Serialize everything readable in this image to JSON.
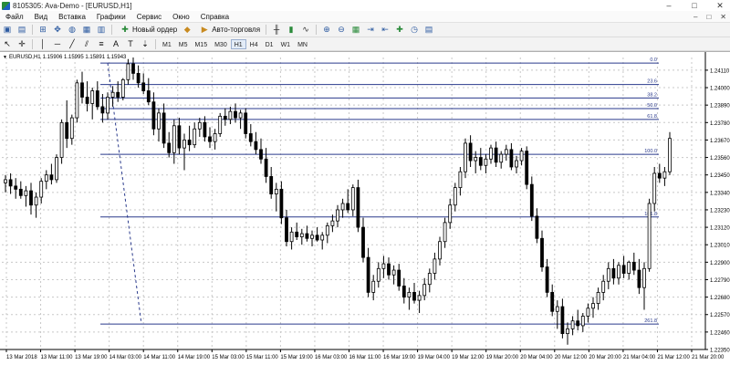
{
  "window": {
    "title": "8105305: Ava-Demo - [EURUSD,H1]",
    "controls": [
      "–",
      "□",
      "✕"
    ]
  },
  "menu": {
    "items": [
      "Файл",
      "Вид",
      "Вставка",
      "Графики",
      "Сервис",
      "Окно",
      "Справка"
    ],
    "mdi_controls": [
      "–",
      "□",
      "✕"
    ]
  },
  "toolbar": {
    "new_order": "Новый ордер",
    "auto_trading": "Авто-торговля",
    "timeframes": [
      "M1",
      "M5",
      "M15",
      "M30",
      "H1",
      "H4",
      "D1",
      "W1",
      "MN"
    ],
    "active_timeframe": "H1"
  },
  "chart": {
    "symbol": "EURUSD,H1",
    "ohlc": "1.15906 1.15995 1.15891 1.15943",
    "price_ticks": [
      "1.24110",
      "1.24000",
      "1.23890",
      "1.23780",
      "1.23670",
      "1.23560",
      "1.23450",
      "1.23340",
      "1.23230",
      "1.23120",
      "1.23010",
      "1.22900",
      "1.22790",
      "1.22680",
      "1.22570",
      "1.22460",
      "1.22350"
    ],
    "time_ticks": [
      "13 Mar 2018",
      "13 Mar 11:00",
      "13 Mar 19:00",
      "14 Mar 03:00",
      "14 Mar 11:00",
      "14 Mar 19:00",
      "15 Mar 03:00",
      "15 Mar 11:00",
      "15 Mar 19:00",
      "16 Mar 03:00",
      "16 Mar 11:00",
      "16 Mar 19:00",
      "19 Mar 04:00",
      "19 Mar 12:00",
      "19 Mar 20:00",
      "20 Mar 04:00",
      "20 Mar 12:00",
      "20 Mar 20:00",
      "21 Mar 04:00",
      "21 Mar 12:00",
      "21 Mar 20:00"
    ],
    "fib_levels": [
      {
        "label": "0.0",
        "price": 1.24155
      },
      {
        "label": "23.6",
        "price": 1.2402
      },
      {
        "label": "38.2",
        "price": 1.23935
      },
      {
        "label": "50.0",
        "price": 1.23868
      },
      {
        "label": "61.8",
        "price": 1.238
      },
      {
        "label": "100.0",
        "price": 1.2358
      },
      {
        "label": "161.8",
        "price": 1.23185
      },
      {
        "label": "261.8",
        "price": 1.2251
      }
    ],
    "colors": {
      "bull": "#ffffff",
      "bear": "#000000",
      "fib": "#2a3a8c",
      "grid": "#c8c8c8",
      "ask_line": "#000000"
    }
  },
  "chart_data": {
    "type": "candlestick",
    "symbol": "EURUSD,H1",
    "ylim": [
      1.2235,
      1.2419
    ],
    "candles": [
      [
        1.234,
        1.2345,
        1.2334,
        1.2342
      ],
      [
        1.2342,
        1.2346,
        1.2333,
        1.2338
      ],
      [
        1.2338,
        1.2343,
        1.233,
        1.2336
      ],
      [
        1.2336,
        1.2341,
        1.233,
        1.2332
      ],
      [
        1.2332,
        1.2338,
        1.2325,
        1.2335
      ],
      [
        1.2335,
        1.234,
        1.232,
        1.2326
      ],
      [
        1.2326,
        1.2334,
        1.2318,
        1.2331
      ],
      [
        1.2331,
        1.2343,
        1.2327,
        1.2341
      ],
      [
        1.2341,
        1.2348,
        1.2336,
        1.2345
      ],
      [
        1.2345,
        1.2352,
        1.2339,
        1.2342
      ],
      [
        1.2342,
        1.2358,
        1.234,
        1.2356
      ],
      [
        1.2356,
        1.238,
        1.2352,
        1.2378
      ],
      [
        1.2378,
        1.2392,
        1.2362,
        1.2368
      ],
      [
        1.2368,
        1.2383,
        1.2364,
        1.2381
      ],
      [
        1.2381,
        1.2405,
        1.2378,
        1.2403
      ],
      [
        1.2403,
        1.241,
        1.239,
        1.2394
      ],
      [
        1.2394,
        1.2404,
        1.2385,
        1.239
      ],
      [
        1.239,
        1.24,
        1.238,
        1.2398
      ],
      [
        1.2398,
        1.2404,
        1.2386,
        1.2388
      ],
      [
        1.2388,
        1.2396,
        1.2378,
        1.2384
      ],
      [
        1.2384,
        1.2397,
        1.238,
        1.2394
      ],
      [
        1.2394,
        1.2401,
        1.2388,
        1.2397
      ],
      [
        1.2397,
        1.2404,
        1.2391,
        1.2394
      ],
      [
        1.2394,
        1.2406,
        1.2392,
        1.2405
      ],
      [
        1.2405,
        1.2418,
        1.2402,
        1.2415
      ],
      [
        1.2415,
        1.2419,
        1.2405,
        1.2409
      ],
      [
        1.2409,
        1.2414,
        1.24,
        1.2403
      ],
      [
        1.2403,
        1.2409,
        1.2396,
        1.2398
      ],
      [
        1.2398,
        1.2406,
        1.2389,
        1.2391
      ],
      [
        1.2391,
        1.2397,
        1.237,
        1.2374
      ],
      [
        1.2374,
        1.2387,
        1.2366,
        1.2384
      ],
      [
        1.2384,
        1.239,
        1.2362,
        1.2365
      ],
      [
        1.2365,
        1.2372,
        1.2356,
        1.2359
      ],
      [
        1.2359,
        1.238,
        1.2352,
        1.2376
      ],
      [
        1.2376,
        1.2381,
        1.2358,
        1.2362
      ],
      [
        1.2362,
        1.2371,
        1.2348,
        1.2367
      ],
      [
        1.2367,
        1.2376,
        1.236,
        1.2364
      ],
      [
        1.2364,
        1.2378,
        1.2362,
        1.2374
      ],
      [
        1.2374,
        1.2381,
        1.2369,
        1.2378
      ],
      [
        1.2378,
        1.2382,
        1.2366,
        1.2369
      ],
      [
        1.2369,
        1.2375,
        1.2362,
        1.2366
      ],
      [
        1.2366,
        1.2374,
        1.2361,
        1.2371
      ],
      [
        1.2371,
        1.2384,
        1.2369,
        1.2382
      ],
      [
        1.2382,
        1.2387,
        1.2376,
        1.238
      ],
      [
        1.238,
        1.2388,
        1.2377,
        1.2385
      ],
      [
        1.2385,
        1.239,
        1.2378,
        1.2381
      ],
      [
        1.2381,
        1.2386,
        1.2374,
        1.2384
      ],
      [
        1.2384,
        1.2387,
        1.2368,
        1.2371
      ],
      [
        1.2371,
        1.2377,
        1.2363,
        1.2366
      ],
      [
        1.2366,
        1.2372,
        1.2358,
        1.2361
      ],
      [
        1.2361,
        1.2368,
        1.2352,
        1.2355
      ],
      [
        1.2355,
        1.2362,
        1.234,
        1.2344
      ],
      [
        1.2344,
        1.235,
        1.233,
        1.2333
      ],
      [
        1.2333,
        1.234,
        1.2322,
        1.2336
      ],
      [
        1.2336,
        1.2341,
        1.2314,
        1.2318
      ],
      [
        1.2318,
        1.2323,
        1.23,
        1.2303
      ],
      [
        1.2303,
        1.2312,
        1.2298,
        1.2309
      ],
      [
        1.2309,
        1.2315,
        1.2304,
        1.2306
      ],
      [
        1.2306,
        1.2311,
        1.2301,
        1.2308
      ],
      [
        1.2308,
        1.2313,
        1.2303,
        1.2305
      ],
      [
        1.2305,
        1.231,
        1.23,
        1.2307
      ],
      [
        1.2307,
        1.2312,
        1.2303,
        1.2304
      ],
      [
        1.2304,
        1.2309,
        1.2298,
        1.2307
      ],
      [
        1.2307,
        1.2315,
        1.2302,
        1.2313
      ],
      [
        1.2313,
        1.232,
        1.2309,
        1.2316
      ],
      [
        1.2316,
        1.2326,
        1.2312,
        1.2323
      ],
      [
        1.2323,
        1.233,
        1.2318,
        1.2327
      ],
      [
        1.2327,
        1.2336,
        1.2321,
        1.2323
      ],
      [
        1.2323,
        1.2339,
        1.2319,
        1.2337
      ],
      [
        1.2337,
        1.2342,
        1.2309,
        1.2312
      ],
      [
        1.2312,
        1.2318,
        1.229,
        1.2293
      ],
      [
        1.2293,
        1.2299,
        1.2268,
        1.2271
      ],
      [
        1.2271,
        1.2282,
        1.2266,
        1.2278
      ],
      [
        1.2278,
        1.229,
        1.2274,
        1.2286
      ],
      [
        1.2286,
        1.2294,
        1.228,
        1.2289
      ],
      [
        1.2289,
        1.2293,
        1.2279,
        1.2282
      ],
      [
        1.2282,
        1.2288,
        1.2276,
        1.2285
      ],
      [
        1.2285,
        1.2289,
        1.2272,
        1.2275
      ],
      [
        1.2275,
        1.228,
        1.2264,
        1.2268
      ],
      [
        1.2268,
        1.2274,
        1.226,
        1.2271
      ],
      [
        1.2271,
        1.2277,
        1.2264,
        1.2266
      ],
      [
        1.2266,
        1.2272,
        1.2258,
        1.2269
      ],
      [
        1.2269,
        1.228,
        1.2266,
        1.2276
      ],
      [
        1.2276,
        1.2286,
        1.2271,
        1.2283
      ],
      [
        1.2283,
        1.2296,
        1.2279,
        1.2292
      ],
      [
        1.2292,
        1.2306,
        1.2288,
        1.2303
      ],
      [
        1.2303,
        1.2318,
        1.2299,
        1.2315
      ],
      [
        1.2315,
        1.233,
        1.2311,
        1.2326
      ],
      [
        1.2326,
        1.234,
        1.2322,
        1.2337
      ],
      [
        1.2337,
        1.235,
        1.2332,
        1.2347
      ],
      [
        1.2347,
        1.2368,
        1.2343,
        1.2365
      ],
      [
        1.2365,
        1.237,
        1.235,
        1.2354
      ],
      [
        1.2354,
        1.236,
        1.2346,
        1.2356
      ],
      [
        1.2356,
        1.2362,
        1.2348,
        1.2351
      ],
      [
        1.2351,
        1.2358,
        1.2346,
        1.2355
      ],
      [
        1.2355,
        1.2364,
        1.2352,
        1.2362
      ],
      [
        1.2362,
        1.2366,
        1.235,
        1.2353
      ],
      [
        1.2353,
        1.236,
        1.2349,
        1.2358
      ],
      [
        1.2358,
        1.2364,
        1.2354,
        1.2361
      ],
      [
        1.2361,
        1.2365,
        1.2348,
        1.235
      ],
      [
        1.235,
        1.2357,
        1.2346,
        1.2354
      ],
      [
        1.2354,
        1.2362,
        1.2351,
        1.236
      ],
      [
        1.236,
        1.2363,
        1.2336,
        1.2339
      ],
      [
        1.2339,
        1.2344,
        1.2316,
        1.2319
      ],
      [
        1.2319,
        1.2324,
        1.2302,
        1.2305
      ],
      [
        1.2305,
        1.231,
        1.2284,
        1.2287
      ],
      [
        1.2287,
        1.2292,
        1.2268,
        1.2271
      ],
      [
        1.2271,
        1.2276,
        1.2256,
        1.2259
      ],
      [
        1.2259,
        1.2266,
        1.2248,
        1.2262
      ],
      [
        1.2262,
        1.2267,
        1.2242,
        1.2245
      ],
      [
        1.2245,
        1.2252,
        1.2238,
        1.2248
      ],
      [
        1.2248,
        1.2256,
        1.2244,
        1.2253
      ],
      [
        1.2253,
        1.226,
        1.2247,
        1.225
      ],
      [
        1.225,
        1.2258,
        1.2246,
        1.2256
      ],
      [
        1.2256,
        1.2264,
        1.2252,
        1.2261
      ],
      [
        1.2261,
        1.2268,
        1.2255,
        1.2264
      ],
      [
        1.2264,
        1.2274,
        1.226,
        1.2271
      ],
      [
        1.2271,
        1.2282,
        1.2266,
        1.2278
      ],
      [
        1.2278,
        1.229,
        1.2273,
        1.2286
      ],
      [
        1.2286,
        1.2292,
        1.2276,
        1.228
      ],
      [
        1.228,
        1.229,
        1.2276,
        1.2288
      ],
      [
        1.2288,
        1.2294,
        1.228,
        1.2283
      ],
      [
        1.2283,
        1.2291,
        1.2279,
        1.229
      ],
      [
        1.229,
        1.2296,
        1.2282,
        1.2285
      ],
      [
        1.2285,
        1.2292,
        1.227,
        1.2274
      ],
      [
        1.2274,
        1.229,
        1.226,
        1.2286
      ],
      [
        1.2286,
        1.233,
        1.2284,
        1.2327
      ],
      [
        1.2327,
        1.235,
        1.2322,
        1.2346
      ],
      [
        1.2346,
        1.2352,
        1.234,
        1.2343
      ],
      [
        1.2343,
        1.235,
        1.2338,
        1.2347
      ],
      [
        1.2347,
        1.2372,
        1.2345,
        1.2368
      ]
    ]
  }
}
